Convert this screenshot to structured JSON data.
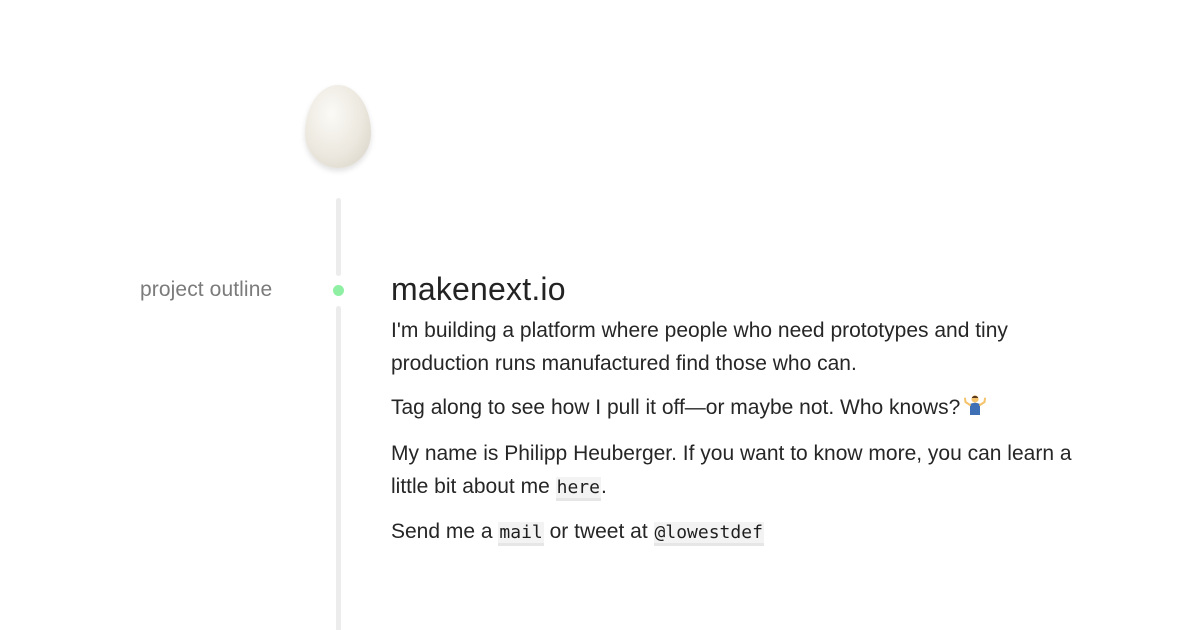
{
  "sidebar": {
    "label": "project outline"
  },
  "timeline": {
    "dot_color": "#8ff0a4",
    "line_color": "#ececec"
  },
  "main": {
    "title": "makenext.io",
    "paragraph_1": "I'm building a platform where people who need prototypes and tiny production runs manufactured find those who can.",
    "paragraph_2": "Tag along to see how I pull it off—or maybe not. Who knows?",
    "paragraph_2_icon": "person-shrugging-icon",
    "paragraph_3_text": "My name is Philipp Heuberger. If you want to know more, you can learn a little bit about me",
    "paragraph_3_link": "here",
    "paragraph_3_end": ".",
    "paragraph_4_text": "Send me a",
    "paragraph_4_mail_link": "mail",
    "paragraph_4_middle": "or tweet at",
    "paragraph_4_twitter_link": "@lowestdef"
  },
  "avatar": {
    "icon": "egg-icon"
  }
}
